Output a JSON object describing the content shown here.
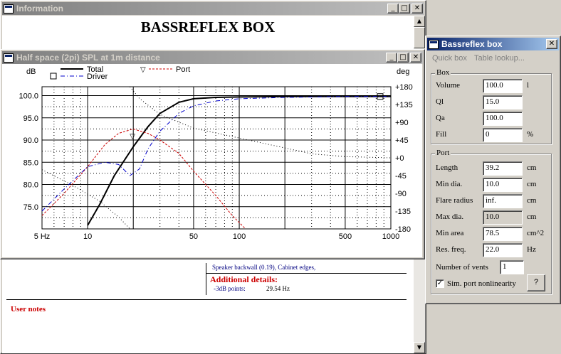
{
  "info_window": {
    "title": "Information",
    "heading": "BASSREFLEX BOX",
    "speaker_line": "Speaker backwall (0.19), Cabinet edges,",
    "additional_title": "Additional details:",
    "detail_label": "-3dB points:",
    "detail_value": "29.54 Hz",
    "user_notes": "User notes"
  },
  "chart_window": {
    "title": "Half space (2pi) SPL at 1m distance"
  },
  "chart_data": {
    "type": "line",
    "ylabel_left": "dB",
    "ylabel_right": "deg",
    "x_scale": "log",
    "xlim": [
      5,
      1000
    ],
    "ylim_left": [
      70,
      102
    ],
    "ylim_right": [
      -180,
      180
    ],
    "x_ticks": [
      "5 Hz",
      "10",
      "50",
      "100",
      "500",
      "1000"
    ],
    "y_ticks_left": [
      "100.0",
      "95.0",
      "90.0",
      "85.0",
      "80.0",
      "75.0"
    ],
    "y_ticks_right": [
      "+180",
      "+135",
      "+90",
      "+45",
      "+0",
      "-45",
      "-90",
      "-135",
      "-180"
    ],
    "legend": [
      "Total",
      "Port",
      "Driver"
    ],
    "series": [
      {
        "name": "Total",
        "axis": "left",
        "color": "#000000",
        "style": "solid",
        "x": [
          10,
          12,
          15,
          20,
          25,
          30,
          40,
          50,
          70,
          100,
          200,
          500,
          1000
        ],
        "y": [
          70.8,
          75.5,
          82,
          88.5,
          93,
          96,
          98.5,
          99.3,
          99.6,
          99.7,
          99.8,
          99.8,
          99.8
        ]
      },
      {
        "name": "Port",
        "axis": "left",
        "color": "#cc0000",
        "style": "dashed",
        "x": [
          5,
          7,
          10,
          13,
          16,
          20,
          25,
          30,
          40,
          50,
          70,
          90,
          110
        ],
        "y": [
          73,
          78,
          84,
          89,
          91.5,
          92.5,
          91.5,
          90,
          87,
          83,
          77.5,
          73,
          70
        ]
      },
      {
        "name": "Driver",
        "axis": "left",
        "color": "#0000cc",
        "style": "dashdot",
        "x": [
          5,
          7,
          10,
          13,
          16,
          19,
          22,
          25,
          30,
          40,
          50,
          70,
          100,
          200,
          500,
          1000
        ],
        "y": [
          74,
          79,
          84,
          85,
          84.5,
          82,
          83.5,
          88,
          92,
          96,
          97.7,
          98.8,
          99.3,
          99.6,
          99.8,
          99.8
        ]
      },
      {
        "name": "Driver phase",
        "axis": "right",
        "color": "#000000",
        "style": "dotted",
        "x": [
          5,
          8,
          12,
          16,
          19
        ],
        "y": [
          -30,
          -70,
          -110,
          -150,
          -180
        ]
      },
      {
        "name": "Total phase",
        "axis": "right",
        "color": "#000000",
        "style": "dotted",
        "x": [
          19,
          22,
          30,
          50,
          100,
          200,
          300,
          500,
          1000
        ],
        "y": [
          180,
          150,
          110,
          75,
          50,
          25,
          10,
          3,
          0
        ]
      }
    ]
  },
  "box_window": {
    "title": "Bassreflex box",
    "menu": [
      "Quick box",
      "Table lookup..."
    ],
    "box_group": "Box",
    "port_group": "Port",
    "box_fields": [
      {
        "label": "Volume",
        "value": "100.0",
        "unit": "l"
      },
      {
        "label": "Ql",
        "value": "15.0",
        "unit": ""
      },
      {
        "label": "Qa",
        "value": "100.0",
        "unit": ""
      },
      {
        "label": "Fill",
        "value": "0",
        "unit": "%"
      }
    ],
    "port_fields": [
      {
        "label": "Length",
        "value": "39.2",
        "unit": "cm"
      },
      {
        "label": "Min dia.",
        "value": "10.0",
        "unit": "cm"
      },
      {
        "label": "Flare radius",
        "value": "inf.",
        "unit": "cm"
      },
      {
        "label": "Max dia.",
        "value": "10.0",
        "unit": "cm"
      },
      {
        "label": "Min area",
        "value": "78.5",
        "unit": "cm^2"
      },
      {
        "label": "Res. freq.",
        "value": "22.0",
        "unit": "Hz"
      }
    ],
    "vents_label": "Number of vents",
    "vents_value": "1",
    "sim_label": "Sim. port nonlinearity",
    "sim_checked": true,
    "help_button": "?"
  }
}
